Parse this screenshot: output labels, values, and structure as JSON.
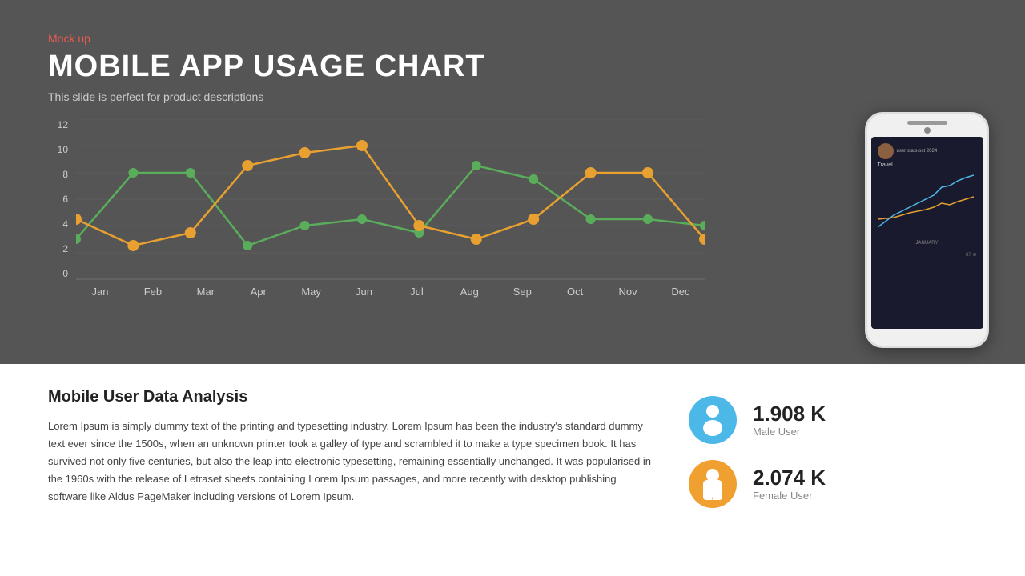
{
  "header": {
    "mock_up_label": "Mock up",
    "title": "MOBILE APP USAGE CHART",
    "subtitle": "This slide is perfect for product descriptions"
  },
  "chart": {
    "y_labels": [
      "0",
      "2",
      "4",
      "6",
      "8",
      "10",
      "12"
    ],
    "x_labels": [
      "Jan",
      "Feb",
      "Mar",
      "Apr",
      "May",
      "Jun",
      "Jul",
      "Aug",
      "Sep",
      "Oct",
      "Nov",
      "Dec"
    ],
    "green_series": [
      3,
      8,
      8,
      2.5,
      4,
      4.5,
      3.5,
      8.5,
      7.5,
      4.5,
      4.5,
      4
    ],
    "orange_series": [
      4.5,
      2.5,
      3.5,
      8.5,
      9.5,
      10,
      4,
      3,
      4.5,
      8,
      8,
      3
    ]
  },
  "bottom": {
    "analysis_title": "Mobile User Data Analysis",
    "analysis_text": "Lorem Ipsum is simply dummy text of the printing and typesetting industry. Lorem Ipsum has been the industry's standard dummy text ever since the 1500s, when an unknown printer took a galley of type and scrambled it to make a type specimen book. It has survived not only five centuries, but also the leap into electronic typesetting, remaining essentially unchanged. It was popularised in the 1960s with the release of Letraset sheets containing Lorem Ipsum passages, and more recently with desktop publishing software like Aldus PageMaker including versions of Lorem Ipsum."
  },
  "stats": {
    "male": {
      "value": "1.908 K",
      "label": "Male User"
    },
    "female": {
      "value": "2.074 K",
      "label": "Female User"
    }
  }
}
